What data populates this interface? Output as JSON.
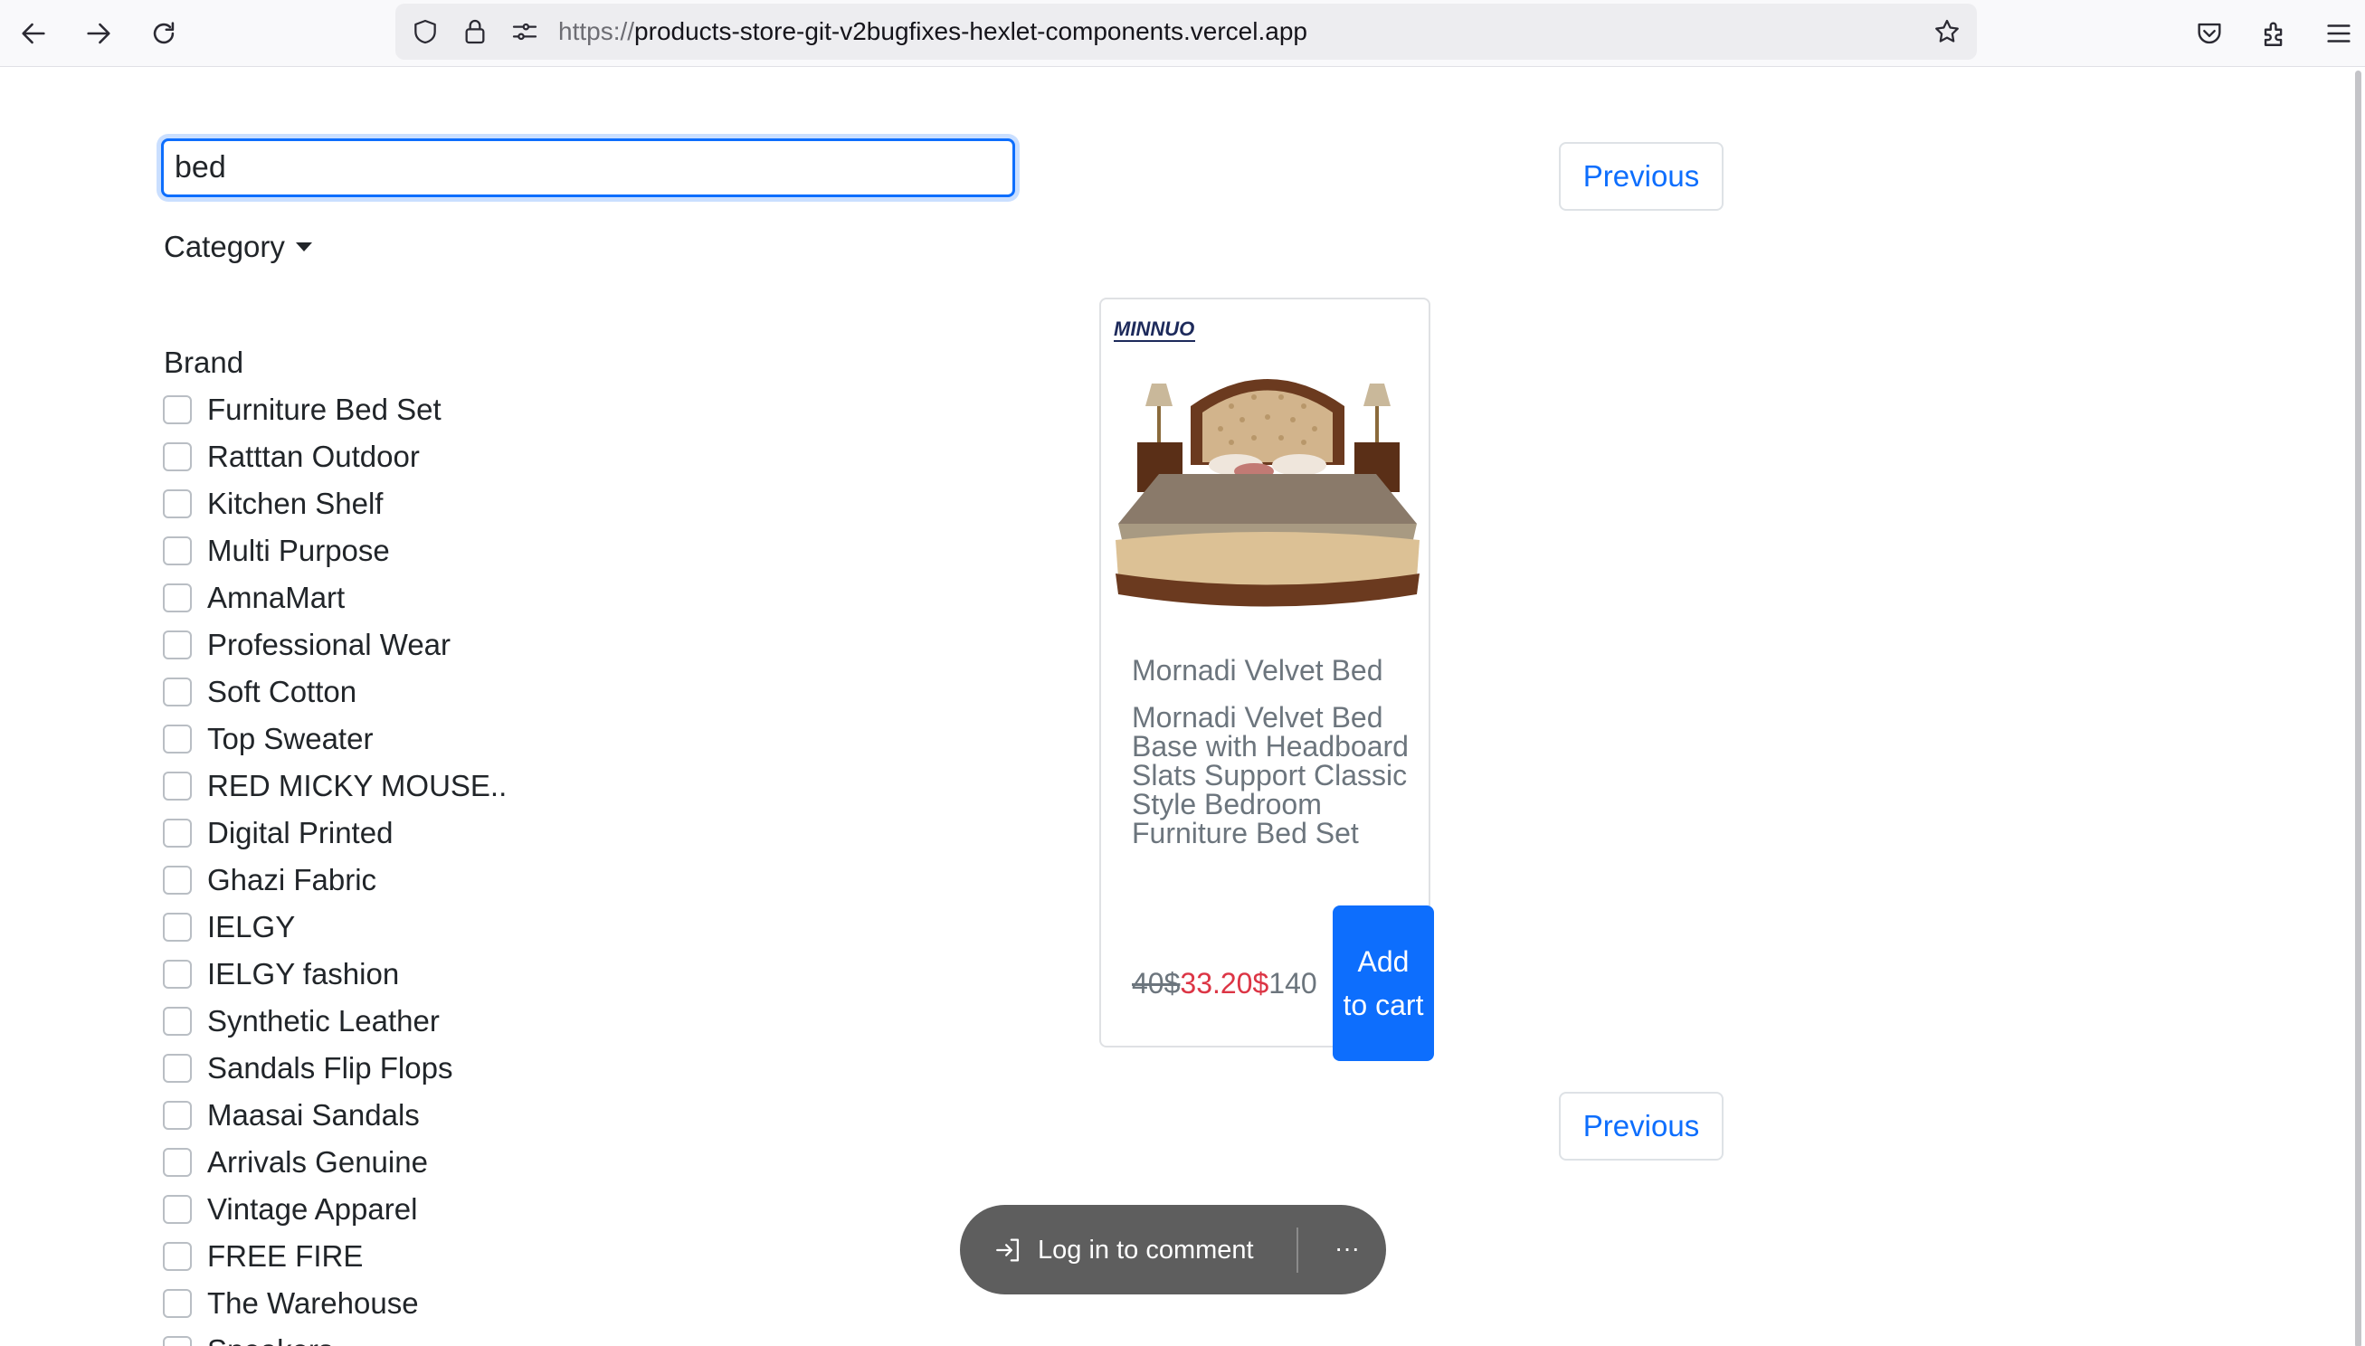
{
  "browser": {
    "url_scheme": "https://",
    "url_host": "products-store-git-v2bugfixes-hexlet-components.vercel.app",
    "icons": [
      "back-arrow-icon",
      "forward-arrow-icon",
      "reload-icon",
      "shield-icon",
      "lock-icon",
      "permissions-icon",
      "star-icon",
      "pocket-icon",
      "extensions-icon",
      "menu-icon"
    ]
  },
  "search": {
    "value": "bed"
  },
  "filters": {
    "category_label": "Category",
    "brand_label": "Brand",
    "brands": [
      "Furniture Bed Set",
      "Ratttan Outdoor",
      "Kitchen Shelf",
      "Multi Purpose",
      "AmnaMart",
      "Professional Wear",
      "Soft Cotton",
      "Top Sweater",
      "RED MICKY MOUSE..",
      "Digital Printed",
      "Ghazi Fabric",
      "IELGY",
      "IELGY fashion",
      "Synthetic Leather",
      "Sandals Flip Flops",
      "Maasai Sandals",
      "Arrivals Genuine",
      "Vintage Apparel",
      "FREE FIRE",
      "The Warehouse",
      "Sneakers"
    ]
  },
  "pagination": {
    "previous_label": "Previous"
  },
  "product": {
    "title": "Mornadi Velvet Bed",
    "description": "Mornadi Velvet Bed Base with Headboard Slats Support Classic Style Bedroom Furniture Bed Set",
    "old_price": "40$",
    "sale_price": "33.20$",
    "base_price": "140",
    "add_to_cart": "Add to cart",
    "image_brand": "MINNUO"
  },
  "comment_bar": {
    "login_label": "Log in to comment",
    "more_label": "···"
  },
  "colors": {
    "primary": "#0d6efd",
    "sale": "#dc3545",
    "muted": "#6c757d"
  }
}
